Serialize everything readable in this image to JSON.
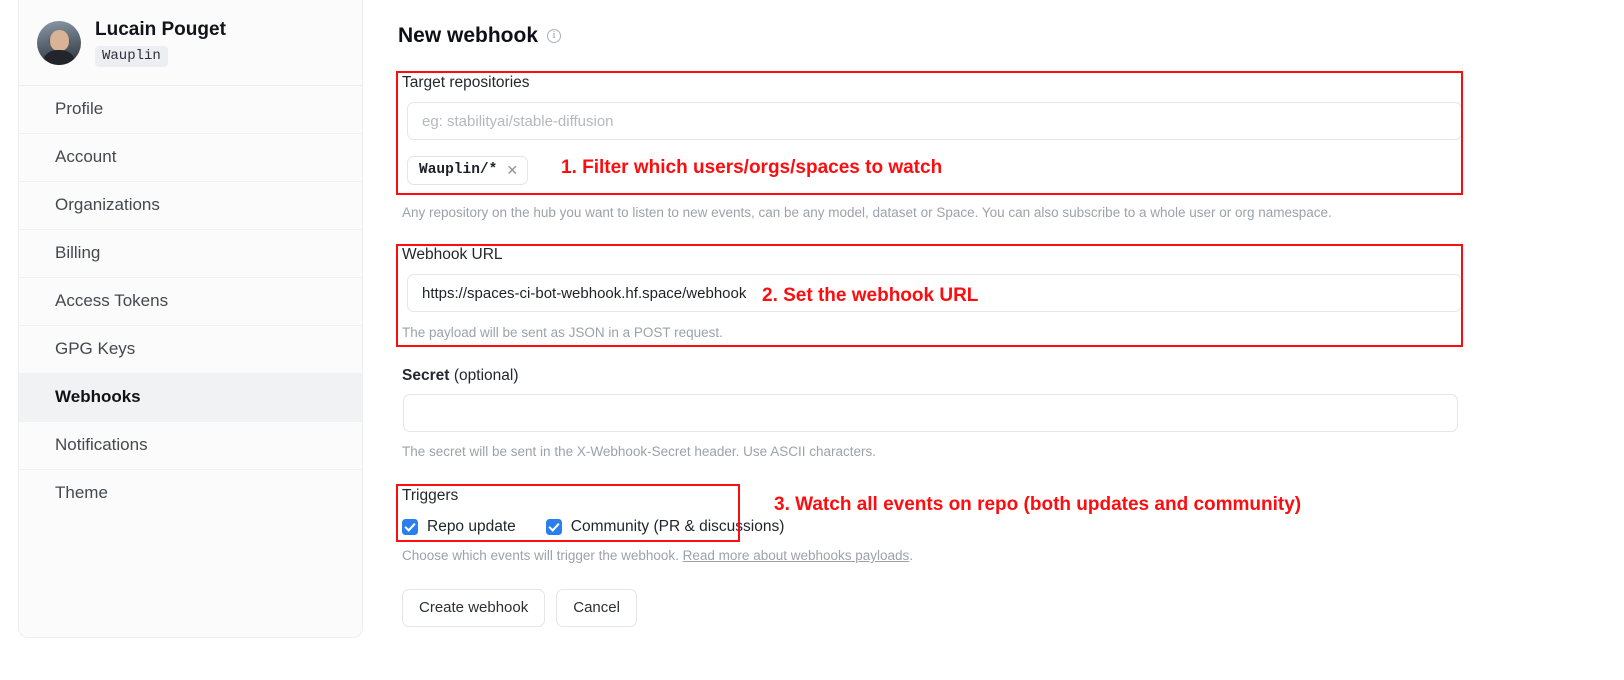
{
  "sidebar": {
    "profile": {
      "name": "Lucain Pouget",
      "handle": "Wauplin",
      "avatar_icon": "user-avatar-photo"
    },
    "items": [
      {
        "label": "Profile",
        "active": false
      },
      {
        "label": "Account",
        "active": false
      },
      {
        "label": "Organizations",
        "active": false
      },
      {
        "label": "Billing",
        "active": false
      },
      {
        "label": "Access Tokens",
        "active": false
      },
      {
        "label": "GPG Keys",
        "active": false
      },
      {
        "label": "Webhooks",
        "active": true
      },
      {
        "label": "Notifications",
        "active": false
      },
      {
        "label": "Theme",
        "active": false
      }
    ]
  },
  "main": {
    "title": "New webhook",
    "title_info_icon": "info-circle-icon",
    "target_repositories": {
      "label": "Target repositories",
      "placeholder": "eg: stabilityai/stable-diffusion",
      "value": "",
      "chips": [
        {
          "label": "Wauplin/*",
          "remove_icon": "close-x-icon"
        }
      ],
      "help": "Any repository on the hub you want to listen to new events, can be any model, dataset or Space. You can also subscribe to a whole user or org namespace."
    },
    "webhook_url": {
      "label": "Webhook URL",
      "value": "https://spaces-ci-bot-webhook.hf.space/webhook",
      "placeholder": "",
      "help": "The payload will be sent as JSON in a POST request."
    },
    "secret": {
      "label": "Secret",
      "optional_suffix": "(optional)",
      "value": "",
      "placeholder": "",
      "help": "The secret will be sent in the X-Webhook-Secret header. Use ASCII characters."
    },
    "triggers": {
      "label": "Triggers",
      "options": [
        {
          "label": "Repo update",
          "checked": true
        },
        {
          "label": "Community (PR & discussions)",
          "checked": true
        }
      ],
      "help_prefix": "Choose which events will trigger the webhook. ",
      "help_link": "Read more about webhooks payloads",
      "help_suffix": "."
    },
    "actions": {
      "submit_label": "Create webhook",
      "cancel_label": "Cancel"
    }
  },
  "annotations": {
    "accent_color": "#fc0d10",
    "notes": [
      {
        "text": "1. Filter which users/orgs/spaces to watch"
      },
      {
        "text": "2. Set the webhook URL"
      },
      {
        "text": "3. Watch all events on repo (both updates and community)"
      }
    ]
  }
}
